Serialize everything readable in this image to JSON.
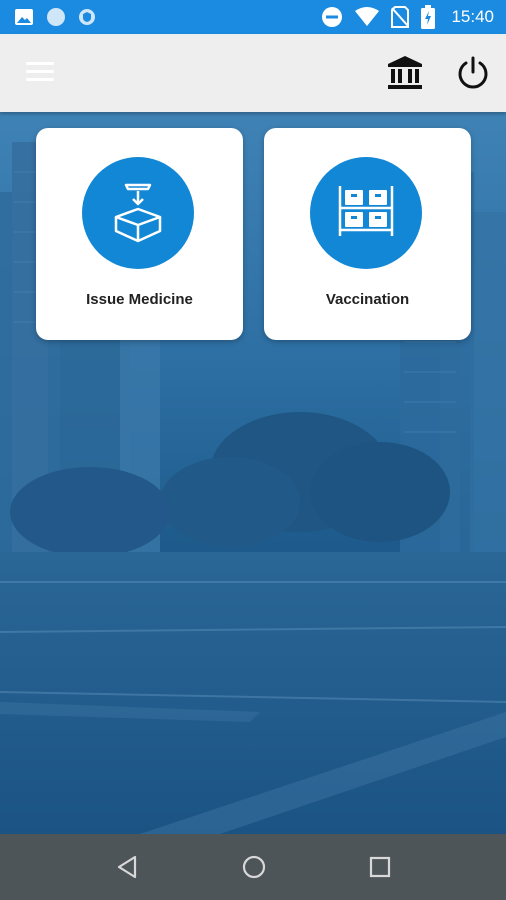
{
  "status_bar": {
    "time": "15:40",
    "left_icons": [
      "gallery-icon",
      "circle-app-icon",
      "shield-app-icon"
    ],
    "right_icons": [
      "do-not-disturb-icon",
      "wifi-icon",
      "no-sim-icon",
      "battery-charging-icon"
    ]
  },
  "app_bar": {
    "left_icon": "hamburger-menu-icon",
    "right_icons": [
      "bank-building-icon",
      "power-icon"
    ]
  },
  "tiles": [
    {
      "label": "Issue Medicine",
      "icon": "box-package-icon"
    },
    {
      "label": "Vaccination",
      "icon": "storage-rack-icon"
    }
  ],
  "nav_bar": {
    "buttons": [
      "back-triangle-icon",
      "home-circle-icon",
      "recents-square-icon"
    ]
  },
  "colors": {
    "status_bar": "#1a8be0",
    "app_bar": "#eeeeee",
    "accent": "#1287d6",
    "nav_bar": "#4e5559"
  }
}
